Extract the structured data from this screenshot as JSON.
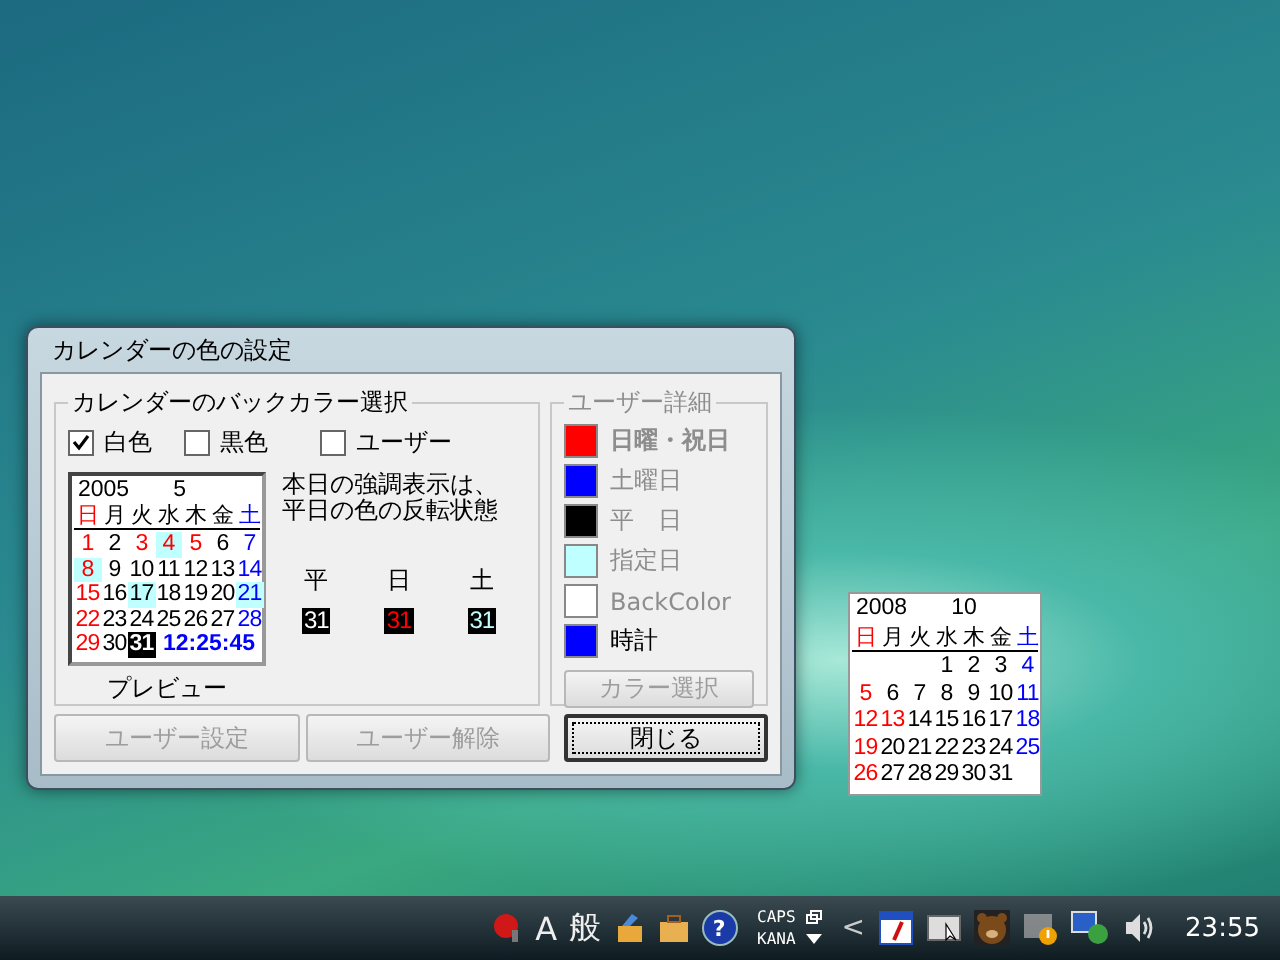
{
  "dialog": {
    "title": "カレンダーの色の設定",
    "back_color_group": {
      "title": "カレンダーのバックカラー選択",
      "options": [
        {
          "label": "白色",
          "checked": true
        },
        {
          "label": "黒色",
          "checked": false
        },
        {
          "label": "ユーザー",
          "checked": false
        }
      ],
      "preview": {
        "year": "2005",
        "month": "5",
        "clock": "12:25:45",
        "caption": "プレビュー",
        "weekdays": [
          {
            "label": "日",
            "kind": "holiday"
          },
          {
            "label": "月",
            "kind": "weekday"
          },
          {
            "label": "火",
            "kind": "weekday"
          },
          {
            "label": "水",
            "kind": "weekday"
          },
          {
            "label": "木",
            "kind": "weekday"
          },
          {
            "label": "金",
            "kind": "weekday"
          },
          {
            "label": "土",
            "kind": "saturday"
          }
        ],
        "days": [
          {
            "day": "1",
            "kind": "holiday",
            "highlighted": false,
            "today": false
          },
          {
            "day": "2",
            "kind": "weekday",
            "highlighted": false,
            "today": false
          },
          {
            "day": "3",
            "kind": "holiday",
            "highlighted": false,
            "today": false
          },
          {
            "day": "4",
            "kind": "holiday",
            "highlighted": true,
            "today": false
          },
          {
            "day": "5",
            "kind": "holiday",
            "highlighted": false,
            "today": false
          },
          {
            "day": "6",
            "kind": "weekday",
            "highlighted": false,
            "today": false
          },
          {
            "day": "7",
            "kind": "saturday",
            "highlighted": false,
            "today": false
          },
          {
            "day": "8",
            "kind": "holiday",
            "highlighted": true,
            "today": false
          },
          {
            "day": "9",
            "kind": "weekday",
            "highlighted": false,
            "today": false
          },
          {
            "day": "10",
            "kind": "weekday",
            "highlighted": false,
            "today": false
          },
          {
            "day": "11",
            "kind": "weekday",
            "highlighted": false,
            "today": false
          },
          {
            "day": "12",
            "kind": "weekday",
            "highlighted": false,
            "today": false
          },
          {
            "day": "13",
            "kind": "weekday",
            "highlighted": false,
            "today": false
          },
          {
            "day": "14",
            "kind": "saturday",
            "highlighted": false,
            "today": false
          },
          {
            "day": "15",
            "kind": "holiday",
            "highlighted": false,
            "today": false
          },
          {
            "day": "16",
            "kind": "weekday",
            "highlighted": false,
            "today": false
          },
          {
            "day": "17",
            "kind": "weekday",
            "highlighted": true,
            "today": false
          },
          {
            "day": "18",
            "kind": "weekday",
            "highlighted": false,
            "today": false
          },
          {
            "day": "19",
            "kind": "weekday",
            "highlighted": false,
            "today": false
          },
          {
            "day": "20",
            "kind": "weekday",
            "highlighted": false,
            "today": false
          },
          {
            "day": "21",
            "kind": "saturday",
            "highlighted": true,
            "today": false
          },
          {
            "day": "22",
            "kind": "holiday",
            "highlighted": false,
            "today": false
          },
          {
            "day": "23",
            "kind": "weekday",
            "highlighted": false,
            "today": false
          },
          {
            "day": "24",
            "kind": "weekday",
            "highlighted": false,
            "today": false
          },
          {
            "day": "25",
            "kind": "weekday",
            "highlighted": false,
            "today": false
          },
          {
            "day": "26",
            "kind": "weekday",
            "highlighted": false,
            "today": false
          },
          {
            "day": "27",
            "kind": "weekday",
            "highlighted": false,
            "today": false
          },
          {
            "day": "28",
            "kind": "saturday",
            "highlighted": false,
            "today": false
          },
          {
            "day": "29",
            "kind": "holiday",
            "highlighted": false,
            "today": false
          },
          {
            "day": "30",
            "kind": "weekday",
            "highlighted": false,
            "today": false
          },
          {
            "day": "31",
            "kind": "weekday",
            "highlighted": false,
            "today": true
          }
        ]
      },
      "note": [
        "本日の強調表示は、",
        "平日の色の反転状態"
      ],
      "samples": [
        {
          "label": "平",
          "value": "31",
          "kind": "weekday"
        },
        {
          "label": "日",
          "value": "31",
          "kind": "holiday"
        },
        {
          "label": "土",
          "value": "31",
          "kind": "saturday"
        }
      ]
    },
    "user_detail_group": {
      "title": "ユーザー詳細",
      "items": [
        {
          "label": "日曜・祝日",
          "color": "#ff0000",
          "disabled": true,
          "bold": true
        },
        {
          "label": "土曜日",
          "color": "#0000ff",
          "disabled": true,
          "bold": false
        },
        {
          "label": "平　日",
          "color": "#000000",
          "disabled": true,
          "bold": false
        },
        {
          "label": "指定日",
          "color": "#c0ffff",
          "disabled": true,
          "bold": false
        },
        {
          "label": "BackColor",
          "color": "#ffffff",
          "disabled": true,
          "bold": false
        },
        {
          "label": "時計",
          "color": "#0000ff",
          "disabled": false,
          "bold": false
        }
      ],
      "button": {
        "label": "カラー選択",
        "disabled": true
      }
    },
    "buttons": [
      {
        "label": "ユーザー設定",
        "disabled": true,
        "default": false
      },
      {
        "label": "ユーザー解除",
        "disabled": true,
        "default": false
      },
      {
        "label": "閉じる",
        "disabled": false,
        "default": true
      }
    ]
  },
  "desktop_calendar": {
    "year": "2008",
    "month": "10",
    "weekdays": [
      {
        "label": "日",
        "kind": "holiday"
      },
      {
        "label": "月",
        "kind": "weekday"
      },
      {
        "label": "火",
        "kind": "weekday"
      },
      {
        "label": "水",
        "kind": "weekday"
      },
      {
        "label": "木",
        "kind": "weekday"
      },
      {
        "label": "金",
        "kind": "weekday"
      },
      {
        "label": "土",
        "kind": "saturday"
      }
    ],
    "days": [
      {
        "day": "1",
        "kind": "weekday"
      },
      {
        "day": "2",
        "kind": "weekday"
      },
      {
        "day": "3",
        "kind": "weekday"
      },
      {
        "day": "4",
        "kind": "saturday"
      },
      {
        "day": "5",
        "kind": "holiday"
      },
      {
        "day": "6",
        "kind": "weekday"
      },
      {
        "day": "7",
        "kind": "weekday"
      },
      {
        "day": "8",
        "kind": "weekday"
      },
      {
        "day": "9",
        "kind": "weekday"
      },
      {
        "day": "10",
        "kind": "weekday"
      },
      {
        "day": "11",
        "kind": "saturday"
      },
      {
        "day": "12",
        "kind": "holiday"
      },
      {
        "day": "13",
        "kind": "holiday"
      },
      {
        "day": "14",
        "kind": "weekday"
      },
      {
        "day": "15",
        "kind": "weekday"
      },
      {
        "day": "16",
        "kind": "weekday"
      },
      {
        "day": "17",
        "kind": "weekday"
      },
      {
        "day": "18",
        "kind": "saturday"
      },
      {
        "day": "19",
        "kind": "holiday"
      },
      {
        "day": "20",
        "kind": "weekday"
      },
      {
        "day": "21",
        "kind": "weekday"
      },
      {
        "day": "22",
        "kind": "weekday"
      },
      {
        "day": "23",
        "kind": "weekday"
      },
      {
        "day": "24",
        "kind": "weekday"
      },
      {
        "day": "25",
        "kind": "saturday"
      },
      {
        "day": "26",
        "kind": "holiday"
      },
      {
        "day": "27",
        "kind": "weekday"
      },
      {
        "day": "28",
        "kind": "weekday"
      },
      {
        "day": "29",
        "kind": "weekday"
      },
      {
        "day": "30",
        "kind": "weekday"
      },
      {
        "day": "31",
        "kind": "weekday"
      }
    ]
  },
  "taskbar": {
    "ime_mode": "A",
    "ime_kanji": "般",
    "caps": "CAPS",
    "kana": "KANA",
    "help": "?",
    "chevron": "<",
    "clock": "23:55"
  }
}
